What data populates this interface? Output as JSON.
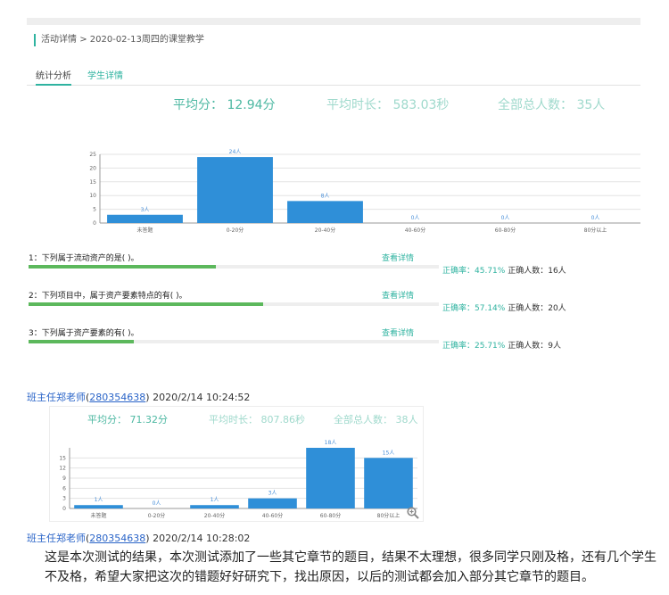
{
  "breadcrumb": {
    "root": "活动详情",
    "separator": ">",
    "current": "2020-02-13周四的课堂教学"
  },
  "tabs": [
    {
      "label": "统计分析"
    },
    {
      "label": "学生详情"
    }
  ],
  "summary": {
    "avg_score": "平均分： 12.94分",
    "avg_duration": "平均时长： 583.03秒",
    "total": "全部总人数： 35人"
  },
  "chart_data": [
    {
      "type": "bar",
      "categories": [
        "未答题",
        "0-20分",
        "20-40分",
        "40-60分",
        "60-80分",
        "80分以上"
      ],
      "values": [
        3,
        24,
        8,
        0,
        0,
        0
      ],
      "data_labels": [
        "3人",
        "24人",
        "8人",
        "0人",
        "0人",
        "0人"
      ],
      "ylim": [
        0,
        25
      ],
      "yticks": [
        "0",
        "5",
        "10",
        "15",
        "20",
        "25"
      ],
      "grid": true,
      "color": "#2f8fd8"
    },
    {
      "type": "bar",
      "categories": [
        "未答题",
        "0-20分",
        "20-40分",
        "40-60分",
        "60-80分",
        "80分以上"
      ],
      "values": [
        1,
        0,
        1,
        3,
        18,
        15
      ],
      "data_labels": [
        "1人",
        "0人",
        "1人",
        "3人",
        "18人",
        "15人"
      ],
      "ylim": [
        0,
        18
      ],
      "yticks": [
        "0",
        "3",
        "6",
        "9",
        "12",
        "15"
      ],
      "grid": true,
      "color": "#2f8fd8"
    }
  ],
  "questions": [
    {
      "title": "1：下列属于流动资产的是( )。",
      "link": "查看详情",
      "accuracy_label": "正确率：",
      "accuracy": "45.71%",
      "correct_label": "正确人数：",
      "correct": "16人",
      "fraction": 0.4571
    },
    {
      "title": "2：下列项目中，属于资产要素特点的有(    )。",
      "link": "查看详情",
      "accuracy_label": "正确率：",
      "accuracy": "57.14%",
      "correct_label": "正确人数：",
      "correct": "20人",
      "fraction": 0.5714
    },
    {
      "title": "3：下列属于资产要素的有( )。",
      "link": "查看详情",
      "accuracy_label": "正确率：",
      "accuracy": "25.71%",
      "correct_label": "正确人数：",
      "correct": "9人",
      "fraction": 0.2571
    }
  ],
  "posts": [
    {
      "author": "班主任郑老师",
      "qq": "280354638",
      "time": "2020/2/14 10:24:52"
    },
    {
      "author": "班主任郑老师",
      "qq": "280354638",
      "time": "2020/2/14 10:28:02"
    }
  ],
  "summary2": {
    "avg_score": "平均分： 71.32分",
    "avg_duration": "平均时长： 807.86秒",
    "total": "全部总人数： 38人"
  },
  "message": "这是本次测试的结果，本次测试添加了一些其它章节的题目，结果不太理想，很多同学只刚及格，还有几个学生不及格，希望大家把这次的错题好好研究下，找出原因，以后的测试都会加入部分其它章节的题目。",
  "icons": {
    "zoom": "zoom-in-icon"
  },
  "colors": {
    "accent": "#2fb3a0",
    "bar": "#2f8fd8",
    "progress": "#5cb85c",
    "link": "#2a64c8"
  }
}
